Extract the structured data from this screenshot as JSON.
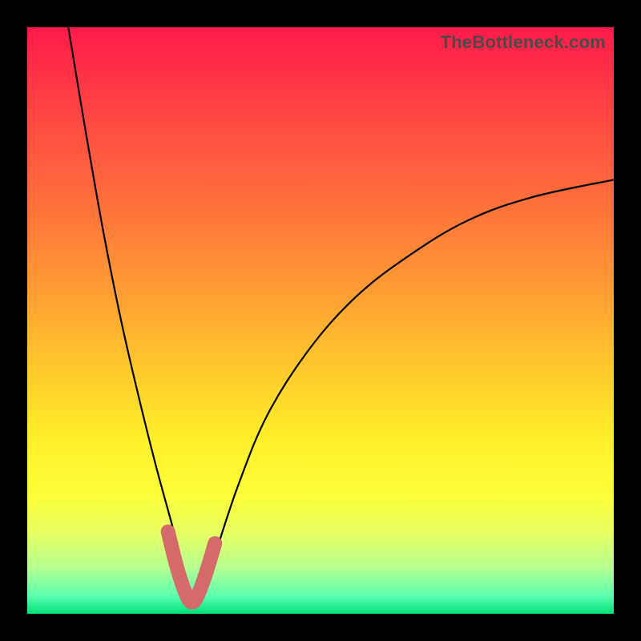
{
  "watermark": "TheBottleneck.com",
  "chart_data": {
    "type": "line",
    "title": "",
    "xlabel": "",
    "ylabel": "",
    "xlim": [
      0,
      100
    ],
    "ylim": [
      0,
      100
    ],
    "grid": false,
    "legend": false,
    "notes": "Unlabeled V-shaped bottleneck curve on a vertical green→red gradient. The minimum sits near x≈28, y≈0; the left branch exits the top edge near x≈7, the right branch exits the right edge near y≈74. A short pink overlay highlights the valley.",
    "series": [
      {
        "name": "curve",
        "x": [
          7,
          10,
          13,
          16,
          19,
          22,
          25,
          27,
          28,
          30,
          32,
          36,
          41,
          48,
          56,
          65,
          75,
          86,
          100
        ],
        "values": [
          100,
          82,
          65,
          50,
          37,
          25,
          14,
          6,
          2,
          4,
          10,
          22,
          34,
          45,
          54,
          61,
          67,
          71,
          74
        ]
      },
      {
        "name": "highlight",
        "x": [
          24,
          25.5,
          27,
          28,
          29,
          30.5,
          32
        ],
        "values": [
          14,
          8,
          3.5,
          2,
          3,
          7,
          12
        ]
      }
    ],
    "background_gradient": {
      "top": "#ff1a4a",
      "bottom": "#00e07a"
    }
  }
}
